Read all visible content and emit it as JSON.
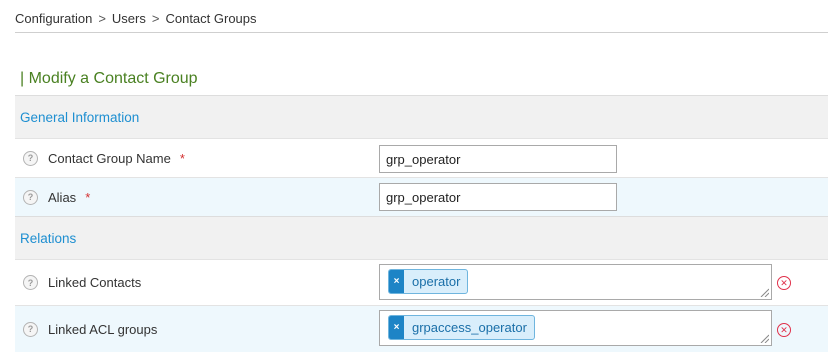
{
  "breadcrumb": {
    "items": [
      "Configuration",
      "Users",
      "Contact Groups"
    ],
    "separator": ">"
  },
  "page": {
    "title": "| Modify a Contact Group"
  },
  "sections": {
    "general": {
      "title": "General Information"
    },
    "relations": {
      "title": "Relations"
    }
  },
  "fields": {
    "name": {
      "label": "Contact Group Name",
      "required_mark": "*",
      "value": "grp_operator",
      "help_icon": "question-circle-icon"
    },
    "alias": {
      "label": "Alias",
      "required_mark": "*",
      "value": "grp_operator",
      "help_icon": "question-circle-icon"
    },
    "linked_contacts": {
      "label": "Linked Contacts",
      "tags": [
        "operator"
      ],
      "tag_remove": "×",
      "remove_icon": "remove-circle-icon"
    },
    "linked_acl": {
      "label": "Linked ACL groups",
      "tags": [
        "grpaccess_operator"
      ],
      "tag_remove": "×",
      "remove_icon": "remove-circle-icon"
    }
  },
  "colors": {
    "title_green": "#4a8122",
    "section_blue": "#1e8fd1",
    "required_red": "#d32f2f",
    "tag_blue": "#1d84c6",
    "remove_red": "#e0304a"
  }
}
